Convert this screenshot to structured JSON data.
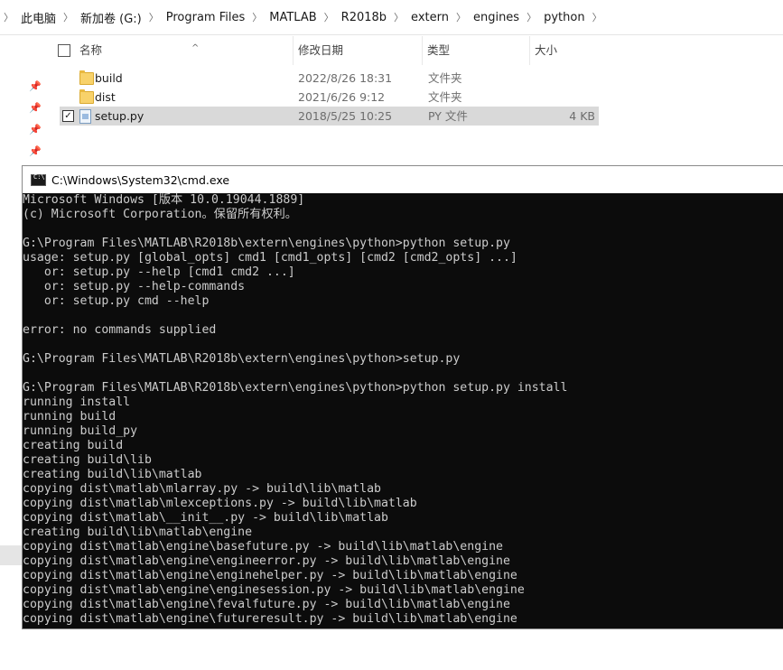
{
  "breadcrumb": [
    "此电脑",
    "新加卷 (G:)",
    "Program Files",
    "MATLAB",
    "R2018b",
    "extern",
    "engines",
    "python"
  ],
  "columns": {
    "name": "名称",
    "modified": "修改日期",
    "type": "类型",
    "size": "大小"
  },
  "files": [
    {
      "name": "build",
      "modified": "2022/8/26 18:31",
      "type": "文件夹",
      "size": "",
      "icon": "folder-icon"
    },
    {
      "name": "dist",
      "modified": "2021/6/26 9:12",
      "type": "文件夹",
      "size": "",
      "icon": "folder-icon"
    },
    {
      "name": "setup.py",
      "modified": "2018/5/25 10:25",
      "type": "PY 文件",
      "size": "4 KB",
      "icon": "py-file-icon",
      "selected": true
    }
  ],
  "cmd": {
    "title": "C:\\Windows\\System32\\cmd.exe",
    "icon_label": "C:\\",
    "lines": [
      "Microsoft Windows [版本 10.0.19044.1889]",
      "(c) Microsoft Corporation。保留所有权利。",
      "",
      "G:\\Program Files\\MATLAB\\R2018b\\extern\\engines\\python>python setup.py",
      "usage: setup.py [global_opts] cmd1 [cmd1_opts] [cmd2 [cmd2_opts] ...]",
      "   or: setup.py --help [cmd1 cmd2 ...]",
      "   or: setup.py --help-commands",
      "   or: setup.py cmd --help",
      "",
      "error: no commands supplied",
      "",
      "G:\\Program Files\\MATLAB\\R2018b\\extern\\engines\\python>setup.py",
      "",
      "G:\\Program Files\\MATLAB\\R2018b\\extern\\engines\\python>python setup.py install",
      "running install",
      "running build",
      "running build_py",
      "creating build",
      "creating build\\lib",
      "creating build\\lib\\matlab",
      "copying dist\\matlab\\mlarray.py -> build\\lib\\matlab",
      "copying dist\\matlab\\mlexceptions.py -> build\\lib\\matlab",
      "copying dist\\matlab\\__init__.py -> build\\lib\\matlab",
      "creating build\\lib\\matlab\\engine",
      "copying dist\\matlab\\engine\\basefuture.py -> build\\lib\\matlab\\engine",
      "copying dist\\matlab\\engine\\engineerror.py -> build\\lib\\matlab\\engine",
      "copying dist\\matlab\\engine\\enginehelper.py -> build\\lib\\matlab\\engine",
      "copying dist\\matlab\\engine\\enginesession.py -> build\\lib\\matlab\\engine",
      "copying dist\\matlab\\engine\\fevalfuture.py -> build\\lib\\matlab\\engine",
      "copying dist\\matlab\\engine\\futureresult.py -> build\\lib\\matlab\\engine"
    ]
  },
  "colors": {
    "console_bg": "#0c0c0c",
    "console_text": "#cccccc",
    "selection": "#d9d9d9",
    "folder": "#f8d26a"
  }
}
